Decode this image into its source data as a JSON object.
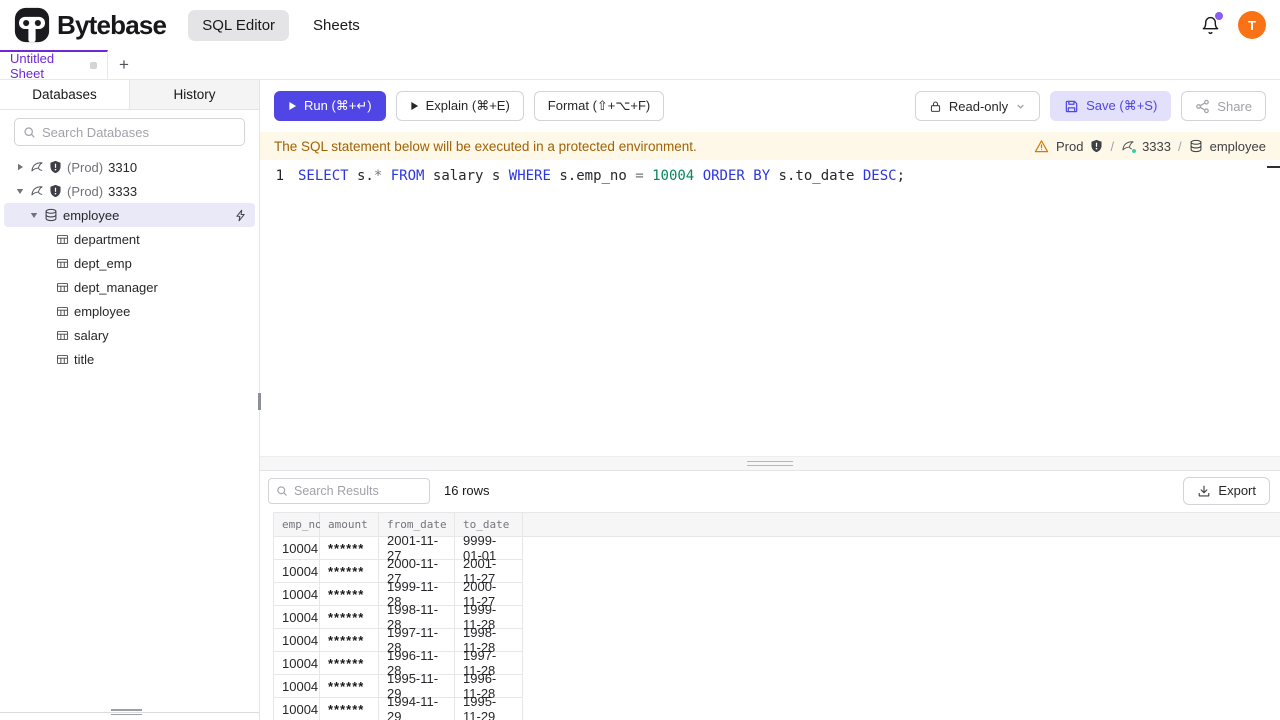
{
  "colors": {
    "accent_purple": "#6d28d9",
    "run_button": "#4f46e5",
    "avatar_orange": "#f97316",
    "banner_bg": "#fdf8e7",
    "banner_text": "#a16207",
    "keyword_blue": "#2b36df",
    "number_green": "#098658",
    "status_green": "#34d399",
    "selected_row": "#e9e9f7"
  },
  "header": {
    "brand": "Bytebase",
    "nav": [
      {
        "label": "SQL Editor"
      },
      {
        "label": "Sheets"
      }
    ],
    "avatar_initial": "T"
  },
  "tabstrip": {
    "active_tab": "Untitled Sheet",
    "new_tab": "+"
  },
  "sidebar": {
    "tabs": [
      {
        "label": "Databases"
      },
      {
        "label": "History"
      }
    ],
    "search_placeholder": "Search Databases",
    "instances": [
      {
        "env": "(Prod)",
        "id": "3310",
        "expanded": false
      },
      {
        "env": "(Prod)",
        "id": "3333",
        "expanded": true
      }
    ],
    "database": "employee",
    "tables": [
      "department",
      "dept_emp",
      "dept_manager",
      "employee",
      "salary",
      "title"
    ]
  },
  "toolbar": {
    "run": "Run (⌘+↵)",
    "explain": "Explain (⌘+E)",
    "format": "Format (⇧+⌥+F)",
    "readonly": "Read-only",
    "save": "Save (⌘+S)",
    "share": "Share"
  },
  "banner": {
    "message": "The SQL statement below will be executed in a protected environment.",
    "environment": "Prod",
    "separator": "/",
    "instance": "3333",
    "database": "employee"
  },
  "editor": {
    "line_number": "1",
    "sql": "SELECT s.* FROM salary s WHERE s.emp_no = 10004 ORDER BY s.to_date DESC;",
    "segments": [
      {
        "text": "SELECT"
      },
      {
        "text": " s."
      },
      {
        "text": "*"
      },
      {
        "text": " "
      },
      {
        "text": "FROM"
      },
      {
        "text": " salary s "
      },
      {
        "text": "WHERE"
      },
      {
        "text": " s.emp_no "
      },
      {
        "text": "="
      },
      {
        "text": " "
      },
      {
        "text": "10004"
      },
      {
        "text": " "
      },
      {
        "text": "ORDER BY"
      },
      {
        "text": " s.to_date "
      },
      {
        "text": "DESC"
      },
      {
        "text": ";"
      }
    ]
  },
  "results": {
    "search_placeholder": "Search Results",
    "row_count": "16 rows",
    "export": "Export",
    "columns": [
      "emp_no",
      "amount",
      "from_date",
      "to_date"
    ],
    "rows": [
      [
        "10004",
        "******",
        "2001-11-27",
        "9999-01-01"
      ],
      [
        "10004",
        "******",
        "2000-11-27",
        "2001-11-27"
      ],
      [
        "10004",
        "******",
        "1999-11-28",
        "2000-11-27"
      ],
      [
        "10004",
        "******",
        "1998-11-28",
        "1999-11-28"
      ],
      [
        "10004",
        "******",
        "1997-11-28",
        "1998-11-28"
      ],
      [
        "10004",
        "******",
        "1996-11-28",
        "1997-11-28"
      ],
      [
        "10004",
        "******",
        "1995-11-29",
        "1996-11-28"
      ],
      [
        "10004",
        "******",
        "1994-11-29",
        "1995-11-29"
      ]
    ]
  }
}
